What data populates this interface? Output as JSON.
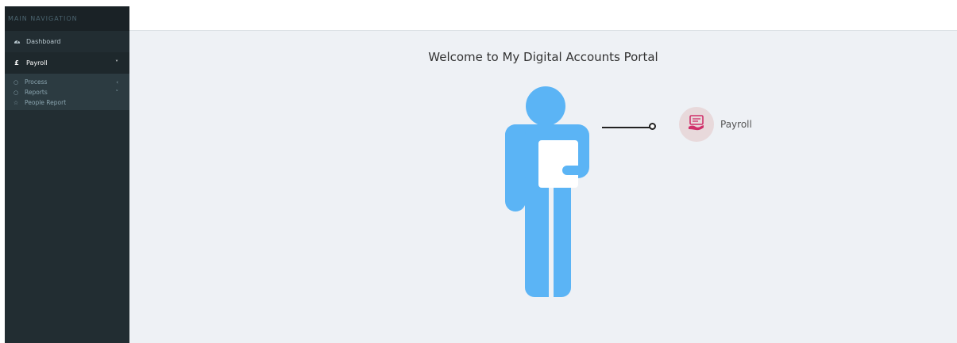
{
  "sidebar": {
    "header": "MAIN NAVIGATION",
    "items": [
      {
        "label": "Dashboard",
        "icon": "dashboard-icon"
      },
      {
        "label": "Payroll",
        "icon": "pound-icon",
        "expanded": true
      }
    ],
    "submenu": [
      {
        "label": "Process",
        "icon": "circle-icon",
        "chevron": "‹"
      },
      {
        "label": "Reports",
        "icon": "circle-icon",
        "chevron": "˅"
      },
      {
        "label": "People Report",
        "icon": "star-icon"
      }
    ]
  },
  "main": {
    "title": "Welcome to My Digital Accounts Portal",
    "payroll_link": "Payroll"
  },
  "colors": {
    "sidebar_bg": "#222d32",
    "figure": "#5bb4f5",
    "badge_bg": "#e8d9db",
    "badge_icon": "#d0306a"
  }
}
